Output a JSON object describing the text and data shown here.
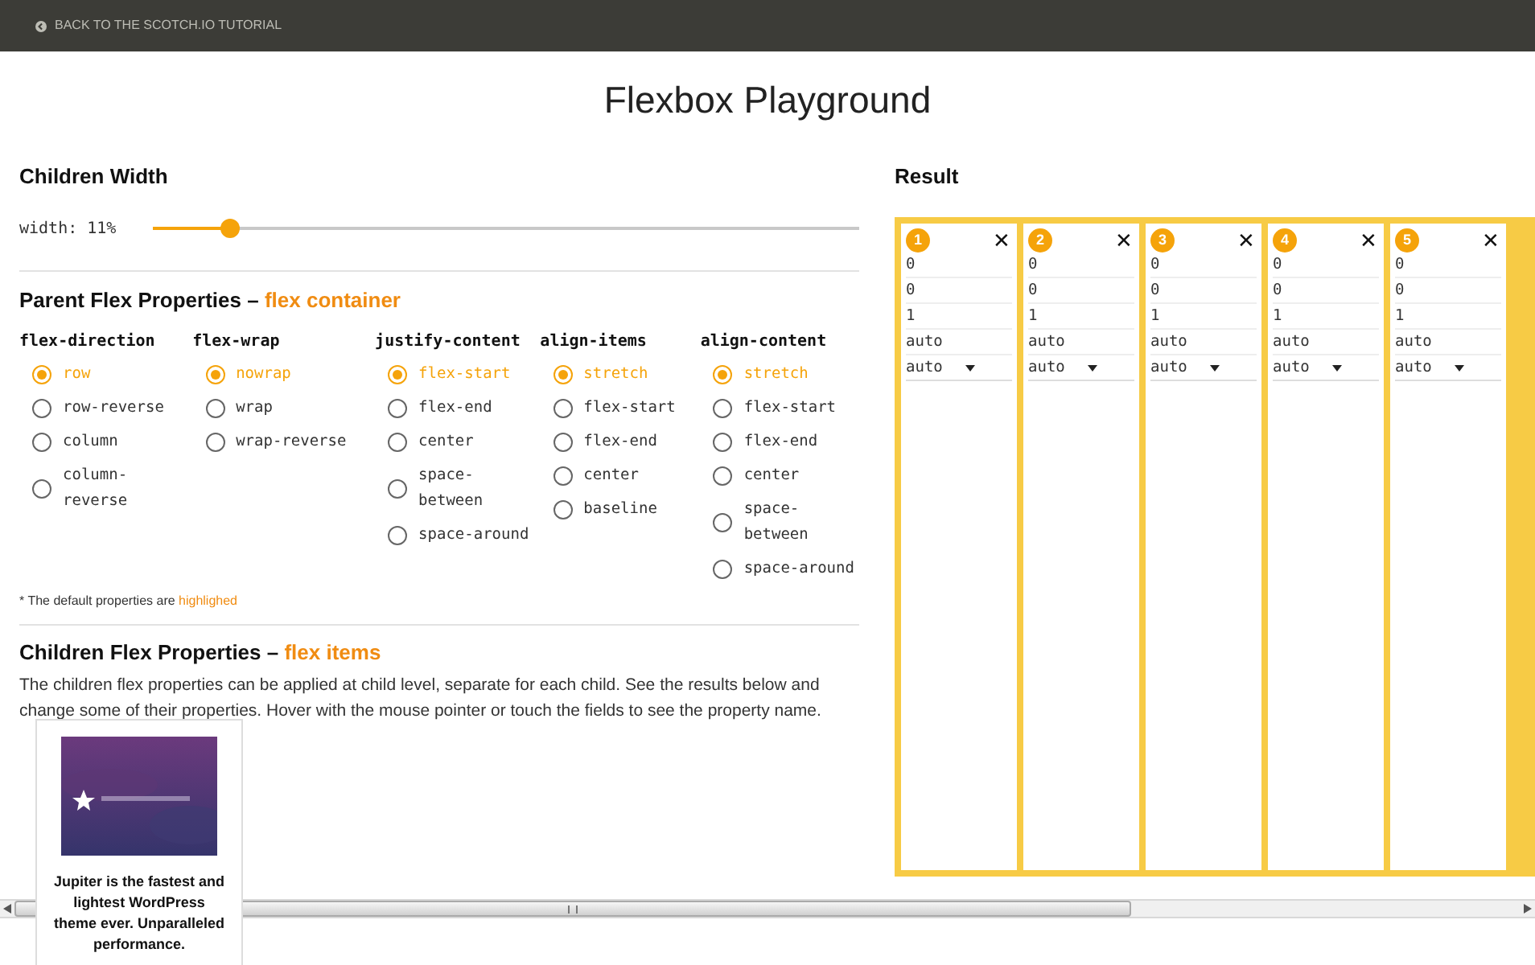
{
  "top_bar": {
    "link": "BACK TO THE SCOTCH.IO TUTORIAL"
  },
  "title": "Flexbox Playground",
  "children_width": {
    "heading": "Children Width",
    "label": "width: 11%",
    "level": 0.11
  },
  "parent": {
    "heading": "Parent Flex Properties –",
    "accent": "flex container",
    "groups": [
      {
        "name": "flex-direction",
        "options": [
          {
            "label": "row",
            "selected": true
          },
          {
            "label": "row-reverse",
            "selected": false
          },
          {
            "label": "column",
            "selected": false
          },
          {
            "label": "column-reverse",
            "selected": false
          }
        ]
      },
      {
        "name": "flex-wrap",
        "options": [
          {
            "label": "nowrap",
            "selected": true
          },
          {
            "label": "wrap",
            "selected": false
          },
          {
            "label": "wrap-reverse",
            "selected": false
          }
        ]
      },
      {
        "name": "justify-content",
        "options": [
          {
            "label": "flex-start",
            "selected": true
          },
          {
            "label": "flex-end",
            "selected": false
          },
          {
            "label": "center",
            "selected": false
          },
          {
            "label": "space-between",
            "selected": false
          },
          {
            "label": "space-around",
            "selected": false
          }
        ]
      },
      {
        "name": "align-items",
        "options": [
          {
            "label": "stretch",
            "selected": true
          },
          {
            "label": "flex-start",
            "selected": false
          },
          {
            "label": "flex-end",
            "selected": false
          },
          {
            "label": "center",
            "selected": false
          },
          {
            "label": "baseline",
            "selected": false
          }
        ]
      },
      {
        "name": "align-content",
        "options": [
          {
            "label": "stretch",
            "selected": true
          },
          {
            "label": "flex-start",
            "selected": false
          },
          {
            "label": "flex-end",
            "selected": false
          },
          {
            "label": "center",
            "selected": false
          },
          {
            "label": "space-between",
            "selected": false
          },
          {
            "label": "space-around",
            "selected": false
          }
        ]
      }
    ],
    "note": "* The default properties are",
    "note_accent": "highlighed"
  },
  "children": {
    "heading": "Children Flex Properties –",
    "accent": "flex items",
    "paragraph": "The children flex properties can be applied at child level, separate for each child. See the results below and change some of their properties. Hover with the mouse pointer or touch the fields to see the property name."
  },
  "result": {
    "heading": "Result",
    "items": [
      {
        "number": "1",
        "close": "✕",
        "fields": [
          "0",
          "0",
          "1",
          "auto"
        ],
        "select": "auto"
      },
      {
        "number": "2",
        "close": "✕",
        "fields": [
          "0",
          "0",
          "1",
          "auto"
        ],
        "select": "auto"
      },
      {
        "number": "3",
        "close": "✕",
        "fields": [
          "0",
          "0",
          "1",
          "auto"
        ],
        "select": "auto"
      },
      {
        "number": "4",
        "close": "✕",
        "fields": [
          "0",
          "0",
          "1",
          "auto"
        ],
        "select": "auto"
      },
      {
        "number": "5",
        "close": "✕",
        "fields": [
          "0",
          "0",
          "1",
          "auto"
        ],
        "select": "auto"
      }
    ]
  },
  "ad": {
    "text": "Jupiter is the fastest and lightest WordPress theme ever. Unparalleled performance."
  }
}
